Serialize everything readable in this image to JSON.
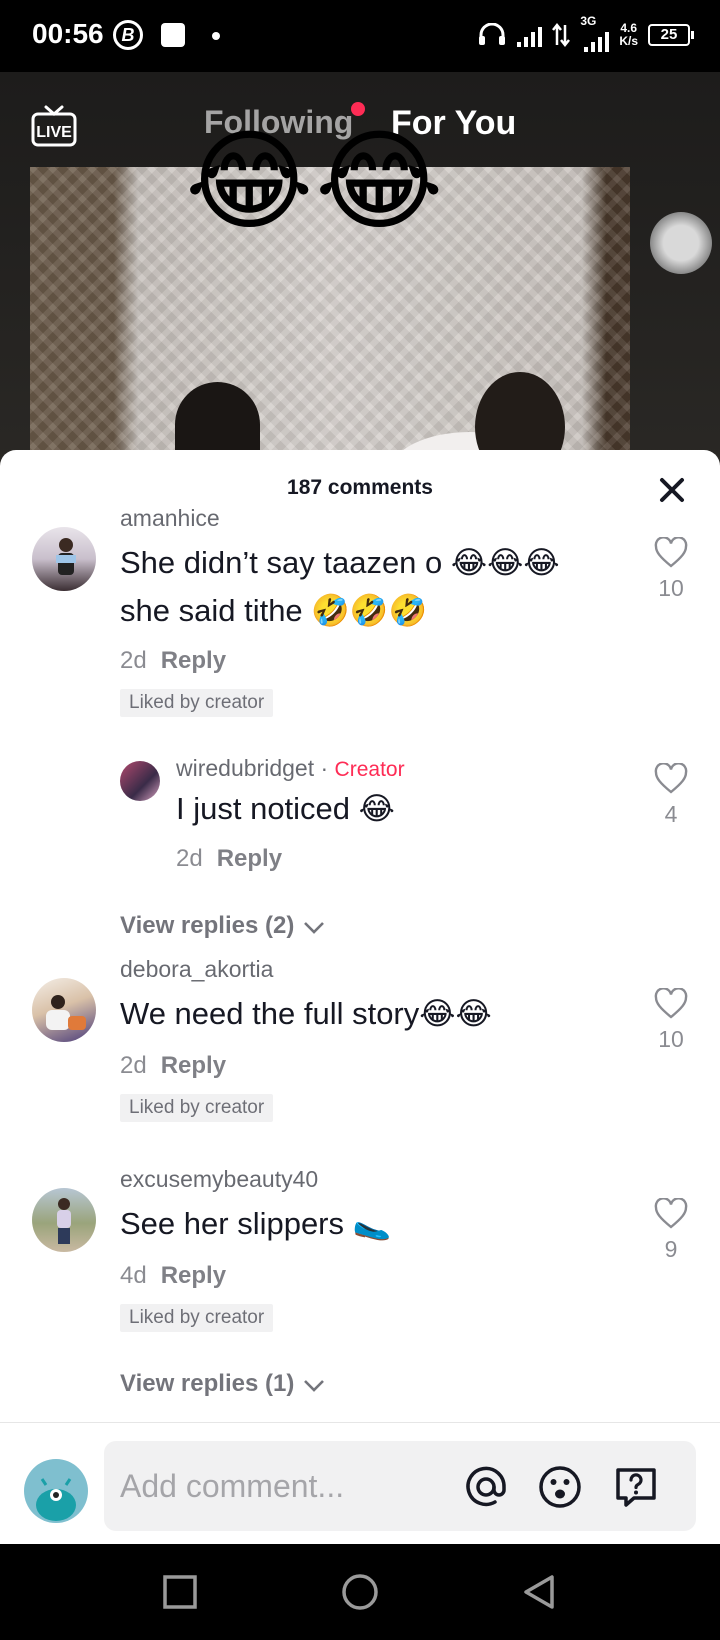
{
  "status": {
    "time": "00:56",
    "b_icon": "B",
    "net_speed_top": "4.6",
    "net_speed_bottom": "K/s",
    "net_type": "3G",
    "battery": "25"
  },
  "header": {
    "tab_following": "Following",
    "tab_for_you": "For You",
    "live_label": "LIVE",
    "overlay_emojis": [
      "😂",
      "😂"
    ]
  },
  "comments_panel": {
    "title": "187 comments",
    "comments": [
      {
        "username": "amanhice",
        "text_line1": "She didn’t say taazen o 😂😂😂",
        "text_line2": "she said tithe 🤣🤣🤣",
        "age": "2d",
        "reply": "Reply",
        "liked_badge": "Liked by creator",
        "likes": "10"
      },
      {
        "username": "wiredubridget",
        "sep": "·",
        "creator_label": "Creator",
        "text": "I just noticed 😂",
        "age": "2d",
        "reply": "Reply",
        "likes": "4"
      },
      {
        "view_replies": "View replies (2)"
      },
      {
        "username": "debora_akortia",
        "text": "We need the full story😂😂",
        "age": "2d",
        "reply": "Reply",
        "liked_badge": "Liked by creator",
        "likes": "10"
      },
      {
        "username": "excusemybeauty40",
        "text": "See her slippers 🥿",
        "age": "4d",
        "reply": "Reply",
        "liked_badge": "Liked by creator",
        "likes": "9"
      },
      {
        "view_replies": "View replies (1)"
      }
    ]
  },
  "input": {
    "placeholder": "Add comment..."
  },
  "colors": {
    "accent": "#fe2c55",
    "text": "#161823",
    "muted": "rgba(22,24,35,0.5)"
  }
}
